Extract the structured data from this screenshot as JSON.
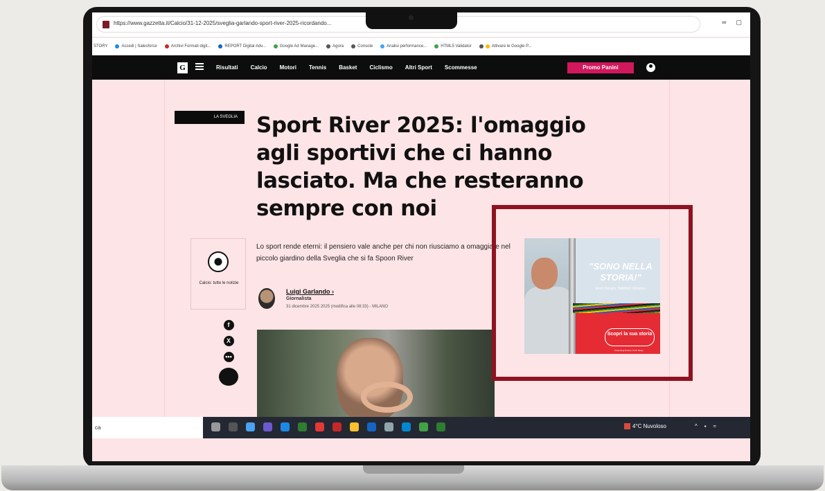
{
  "browser": {
    "url": "https://www.gazzetta.it/Calcio/31-12-2025/sveglia-garlando-sport-river-2025-ricordando...",
    "bookmarks": [
      "STORY",
      "Accedi | Salesforce",
      "Archivi Formati digit...",
      "REPORT Digital Adv...",
      "Google Ad Manage...",
      "Agora",
      "Console",
      "Analisi performance...",
      "HTML5 Validator",
      "Attivare le Google P..."
    ]
  },
  "site_nav": {
    "logo": "G",
    "items": [
      "Risultati",
      "Calcio",
      "Motori",
      "Tennis",
      "Basket",
      "Ciclismo",
      "Altri Sport",
      "Scommesse"
    ],
    "promo": "Promo Panini"
  },
  "article": {
    "tag": "LA SVEGLIA",
    "headline": "Sport River 2025: l'omaggio agli sportivi che ci hanno lasciato. Ma che resteranno sempre con noi",
    "summary": "Lo sport rende eterni: il pensiero vale anche per chi non riusciamo a omaggiare nel piccolo giardino della Sveglia che si fa Spoon River",
    "sidecard_label": "Calcio: tutte le notizie",
    "author": {
      "name": "Luigi Garlando",
      "role": "Giornalista",
      "date": "31 dicembre 2025 2025 (modifica alle 08:33) - MILANO"
    },
    "share_icons": [
      "facebook-icon",
      "x-icon",
      "more-icon",
      "comment-icon"
    ]
  },
  "ad": {
    "headline": "\"SONO NELLA STORIA!\"",
    "subtitle": "Enzo Decaro, Tedoforo Olimpico",
    "cta": "Scopri la sua storia",
    "fine_print": "Presenting Partner Torch Relay"
  },
  "taskbar": {
    "search_text": "ca",
    "weather": "4°C Nuvoloso"
  },
  "colors": {
    "page_bg": "#fde4e6",
    "nav_bg": "#0d0d0d",
    "promo": "#d1185d",
    "highlight": "#8e1220",
    "ad_red": "#e52b34"
  }
}
